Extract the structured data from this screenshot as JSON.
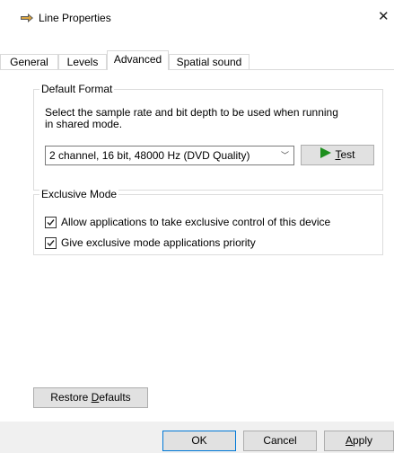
{
  "window": {
    "title": "Line Properties",
    "close_glyph": "✕",
    "icon": "speaker-line-icon"
  },
  "tabs": [
    {
      "label": "General",
      "active": false
    },
    {
      "label": "Levels",
      "active": false
    },
    {
      "label": "Advanced",
      "active": true
    },
    {
      "label": "Spatial sound",
      "active": false
    }
  ],
  "default_format": {
    "label": "Default Format",
    "description_line1": "Select the sample rate and bit depth to be used when running",
    "description_line2": "in shared mode.",
    "selected_format": "2 channel, 16 bit, 48000 Hz (DVD Quality)",
    "test_button": {
      "underlined": "T",
      "rest": "est"
    }
  },
  "exclusive_mode": {
    "label": "Exclusive Mode",
    "options": [
      {
        "label": "Allow applications to take exclusive control of this device",
        "checked": true
      },
      {
        "label": "Give exclusive mode applications priority",
        "checked": true
      }
    ]
  },
  "restore_defaults": {
    "prefix": "Restore ",
    "underlined": "D",
    "rest": "efaults"
  },
  "footer": {
    "ok": "OK",
    "cancel": "Cancel",
    "apply": {
      "underlined": "A",
      "rest": "pply"
    }
  },
  "colors": {
    "accent": "#0078d7",
    "play_icon": "#1e8f1e"
  }
}
